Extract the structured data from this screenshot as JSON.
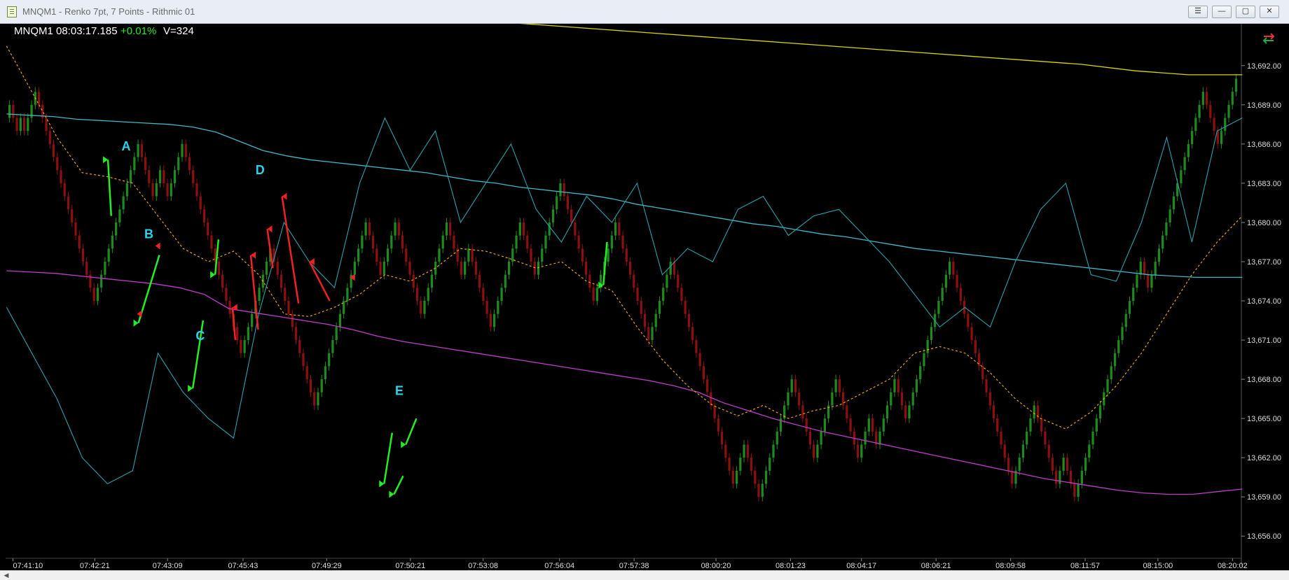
{
  "window": {
    "title": "MNQM1 - Renko 7pt, 7 Points - Rithmic 01",
    "buttons": [
      "☰",
      "—",
      "▢",
      "✕"
    ]
  },
  "header": {
    "instrument": "MNQM1",
    "time": "08:03:17.185",
    "change": "+0.01%",
    "volume": "V=324"
  },
  "colors": {
    "background": "#000000",
    "up_brick": "#1f8a1f",
    "down_brick": "#8b1010",
    "upper_band": "#3fb8c8",
    "lower_band": "#c03ccc",
    "long_ma": "#d6d600",
    "fast_ma": "#ffb000",
    "oscillator": "#2aa0ad",
    "long_signal": "#22ee22",
    "short_signal": "#ee2222",
    "annotation": "#29d3ec"
  },
  "chart_data": {
    "type": "renko",
    "brick_size_points": 7,
    "ylim": [
      13654.3,
      13695.2
    ],
    "y_ticks": [
      "13,692.00",
      "13,689.00",
      "13,686.00",
      "13,683.00",
      "13,680.00",
      "13,677.00",
      "13,674.00",
      "13,671.00",
      "13,668.00",
      "13,665.00",
      "13,662.00",
      "13,659.00",
      "13,656.00"
    ],
    "y_tick_values": [
      13692,
      13689,
      13686,
      13683,
      13680,
      13677,
      13674,
      13671,
      13668,
      13665,
      13662,
      13659,
      13656
    ],
    "x_ticks": [
      "07:41:10",
      "07:42:21",
      "07:43:09",
      "07:45:43",
      "07:49:29",
      "07:50:21",
      "07:53:08",
      "07:56:04",
      "07:57:38",
      "08:00:20",
      "08:01:23",
      "08:04:17",
      "08:06:21",
      "08:09:58",
      "08:11:57",
      "08:15:00",
      "08:20:02"
    ],
    "x_tick_positions": [
      0.25,
      4.75,
      8.75,
      12.9,
      17.5,
      22.1,
      26.1,
      30.3,
      34.4,
      38.9,
      43.0,
      46.9,
      51.0,
      55.1,
      59.2,
      63.2,
      67.3
    ],
    "brick_closes": [
      13689,
      13688,
      13687,
      13688,
      13687,
      13688,
      13689,
      13690,
      13689,
      13688,
      13687,
      13686,
      13685,
      13684,
      13683,
      13682,
      13681,
      13680,
      13679,
      13678,
      13677,
      13676,
      13675,
      13674,
      13675,
      13676,
      13677,
      13678,
      13679,
      13680,
      13681,
      13682,
      13683,
      13684,
      13685,
      13686,
      13685,
      13684,
      13683,
      13682,
      13683,
      13684,
      13683,
      13682,
      13683,
      13684,
      13685,
      13686,
      13685,
      13684,
      13683,
      13682,
      13681,
      13680,
      13679,
      13678,
      13677,
      13676,
      13675,
      13674,
      13673,
      13672,
      13671,
      13670,
      13671,
      13672,
      13673,
      13674,
      13675,
      13676,
      13677,
      13678,
      13677,
      13676,
      13675,
      13674,
      13673,
      13672,
      13671,
      13670,
      13669,
      13668,
      13667,
      13666,
      13667,
      13668,
      13669,
      13670,
      13671,
      13672,
      13673,
      13674,
      13675,
      13676,
      13677,
      13678,
      13679,
      13680,
      13679,
      13678,
      13677,
      13676,
      13677,
      13678,
      13679,
      13680,
      13679,
      13678,
      13677,
      13676,
      13675,
      13674,
      13673,
      13674,
      13675,
      13676,
      13677,
      13678,
      13679,
      13680,
      13679,
      13678,
      13677,
      13676,
      13677,
      13678,
      13677,
      13676,
      13675,
      13674,
      13673,
      13672,
      13673,
      13674,
      13675,
      13676,
      13677,
      13678,
      13679,
      13680,
      13679,
      13678,
      13677,
      13676,
      13677,
      13678,
      13679,
      13680,
      13681,
      13682,
      13683,
      13682,
      13681,
      13680,
      13679,
      13678,
      13677,
      13676,
      13675,
      13674,
      13675,
      13676,
      13677,
      13678,
      13679,
      13680,
      13679,
      13678,
      13677,
      13676,
      13675,
      13674,
      13673,
      13672,
      13671,
      13672,
      13673,
      13674,
      13675,
      13676,
      13677,
      13676,
      13675,
      13674,
      13673,
      13672,
      13671,
      13670,
      13669,
      13668,
      13667,
      13666,
      13665,
      13664,
      13663,
      13662,
      13661,
      13660,
      13661,
      13662,
      13663,
      13662,
      13661,
      13660,
      13659,
      13660,
      13661,
      13662,
      13663,
      13664,
      13665,
      13666,
      13667,
      13668,
      13667,
      13666,
      13665,
      13664,
      13663,
      13662,
      13663,
      13664,
      13665,
      13666,
      13667,
      13668,
      13667,
      13666,
      13665,
      13664,
      13663,
      13662,
      13663,
      13664,
      13665,
      13664,
      13663,
      13664,
      13665,
      13666,
      13667,
      13668,
      13667,
      13666,
      13665,
      13666,
      13667,
      13668,
      13669,
      13670,
      13671,
      13672,
      13673,
      13674,
      13675,
      13676,
      13677,
      13676,
      13675,
      13674,
      13673,
      13672,
      13671,
      13670,
      13669,
      13668,
      13667,
      13666,
      13665,
      13664,
      13663,
      13662,
      13661,
      13660,
      13661,
      13662,
      13663,
      13664,
      13665,
      13666,
      13665,
      13664,
      13663,
      13662,
      13661,
      13660,
      13661,
      13662,
      13661,
      13660,
      13659,
      13660,
      13661,
      13662,
      13663,
      13664,
      13665,
      13666,
      13667,
      13668,
      13669,
      13670,
      13671,
      13672,
      13673,
      13674,
      13675,
      13676,
      13677,
      13676,
      13675,
      13676,
      13677,
      13678,
      13679,
      13680,
      13681,
      13682,
      13683,
      13684,
      13685,
      13686,
      13687,
      13688,
      13689,
      13690,
      13689,
      13688,
      13687,
      13686,
      13687,
      13688,
      13689,
      13690,
      13691
    ],
    "series": [
      {
        "type": "line",
        "values": [
          13688.3,
          13688.2,
          13688.1,
          13687.9,
          13687.8,
          13687.7,
          13687.6,
          13687.5,
          13687.3,
          13686.9,
          13686.2,
          13685.5,
          13685.1,
          13684.8,
          13684.6,
          13684.4,
          13684.2,
          13684.0,
          13683.8,
          13683.5,
          13683.2,
          13683.0,
          13682.7,
          13682.5,
          13682.3,
          13682.1,
          13681.8,
          13681.4,
          13681.1,
          13680.8,
          13680.5,
          13680.2,
          13679.9,
          13679.7,
          13679.4,
          13679.1,
          13678.9,
          13678.6,
          13678.3,
          13678.0,
          13677.8,
          13677.6,
          13677.4,
          13677.2,
          13677.0,
          13676.8,
          13676.6,
          13676.4,
          13676.2,
          13676.0,
          13675.9,
          13675.8,
          13675.8,
          13675.8
        ]
      },
      {
        "type": "line",
        "values": [
          13676.3,
          13676.2,
          13676.1,
          13675.9,
          13675.7,
          13675.5,
          13675.3,
          13675.0,
          13674.5,
          13673.4,
          13673.1,
          13672.8,
          13672.5,
          13672.2,
          13671.8,
          13671.3,
          13670.9,
          13670.6,
          13670.3,
          13670.0,
          13669.7,
          13669.4,
          13669.1,
          13668.8,
          13668.5,
          13668.2,
          13667.9,
          13667.5,
          13667.0,
          13666.2,
          13665.6,
          13665.0,
          13664.5,
          13664.0,
          13663.6,
          13663.2,
          13662.8,
          13662.4,
          13662.0,
          13661.6,
          13661.2,
          13660.8,
          13660.4,
          13660.1,
          13659.8,
          13659.5,
          13659.3,
          13659.2,
          13659.2,
          13659.4,
          13659.6
        ]
      },
      {
        "type": "line",
        "values": [
          13697.5,
          13697.4,
          13697.3,
          13697.1,
          13696.9,
          13696.6,
          13696.3,
          13696.0,
          13695.7,
          13695.4,
          13695.1,
          13694.8,
          13694.5,
          13694.2,
          13693.9,
          13693.6,
          13693.3,
          13693.0,
          13692.7,
          13692.4,
          13692.1,
          13691.6,
          13691.3,
          13691.3
        ]
      },
      {
        "type": "line",
        "values": [
          13693.5,
          13690.0,
          13686.5,
          13683.8,
          13683.5,
          13683.0,
          13680.5,
          13678.0,
          13677.0,
          13677.8,
          13676.0,
          13673.0,
          13672.8,
          13673.5,
          13674.5,
          13676.0,
          13675.5,
          13676.5,
          13678.0,
          13677.8,
          13677.2,
          13676.5,
          13677.0,
          13675.5,
          13674.8,
          13672.0,
          13669.5,
          13667.5,
          13666.0,
          13665.2,
          13666.0,
          13665.0,
          13665.6,
          13666.0,
          13667.0,
          13668.0,
          13670.0,
          13670.5,
          13670.0,
          13668.5,
          13666.5,
          13665.0,
          13664.2,
          13665.5,
          13667.5,
          13670.0,
          13673.0,
          13676.0,
          13678.5,
          13680.5
        ]
      },
      {
        "type": "line",
        "values": [
          13673.5,
          13670.0,
          13666.5,
          13662.0,
          13660.0,
          13661.0,
          13670.0,
          13667.0,
          13665.0,
          13663.5,
          13673.0,
          13680.0,
          13677.0,
          13675.0,
          13683.0,
          13688.0,
          13684.0,
          13687.0,
          13680.0,
          13683.0,
          13686.0,
          13681.0,
          13678.5,
          13682.0,
          13680.0,
          13683.0,
          13676.0,
          13678.0,
          13677.0,
          13681.0,
          13682.0,
          13679.0,
          13680.5,
          13681.0,
          13679.0,
          13677.0,
          13674.5,
          13672.0,
          13673.5,
          13672.0,
          13677.0,
          13681.0,
          13683.0,
          13676.0,
          13675.5,
          13680.0,
          13686.5,
          13678.5,
          13687.0,
          13688.0
        ]
      }
    ],
    "signals": {
      "long": [
        {
          "x": 27.1,
          "y": 13684.8,
          "dir": "down",
          "x2": 28.0,
          "y2": 13680.5
        },
        {
          "x": 35.4,
          "y": 13672.3,
          "dir": "up",
          "x2": 41.1,
          "y2": 13677.5
        },
        {
          "x": 50.2,
          "y": 13667.3,
          "dir": "up",
          "x2": 53.0,
          "y2": 13672.5
        },
        {
          "x": 56.3,
          "y": 13676.0,
          "dir": "up",
          "x2": 57.2,
          "y2": 13678.7
        },
        {
          "x": 102.3,
          "y": 13660.0,
          "dir": "up",
          "x2": 104.5,
          "y2": 13663.9
        },
        {
          "x": 105.0,
          "y": 13659.2,
          "dir": "up",
          "x2": 107.5,
          "y2": 13660.6
        },
        {
          "x": 108.2,
          "y": 13663.0,
          "dir": "up",
          "x2": 111.1,
          "y2": 13665.0
        },
        {
          "x": 162.0,
          "y": 13675.2,
          "dir": "up",
          "x2": 163.0,
          "y2": 13678.5
        }
      ],
      "short": [
        {
          "x": 35.0,
          "y": 13673.0,
          "dir": "down"
        },
        {
          "x": 40.0,
          "y": 13678.2,
          "dir": "down"
        },
        {
          "x": 61.0,
          "y": 13673.5,
          "dir": "down",
          "x2": 61.8,
          "y2": 13671.0
        },
        {
          "x": 66.0,
          "y": 13677.5,
          "dir": "down",
          "x2": 68.0,
          "y2": 13671.8
        },
        {
          "x": 70.5,
          "y": 13679.5,
          "dir": "down",
          "x2": 72.0,
          "y2": 13676.5
        },
        {
          "x": 74.5,
          "y": 13682.0,
          "dir": "down",
          "x2": 79.0,
          "y2": 13673.8
        },
        {
          "x": 82.0,
          "y": 13677.0,
          "dir": "down",
          "x2": 87.5,
          "y2": 13674.0
        },
        {
          "x": 93.0,
          "y": 13675.8,
          "dir": "down"
        }
      ]
    },
    "labels": [
      {
        "text": "A",
        "x": 30.8,
        "y": 13685.5
      },
      {
        "text": "B",
        "x": 37.0,
        "y": 13678.8
      },
      {
        "text": "C",
        "x": 51.0,
        "y": 13671.0
      },
      {
        "text": "D",
        "x": 67.3,
        "y": 13683.7
      },
      {
        "text": "E",
        "x": 105.3,
        "y": 13666.8
      }
    ]
  }
}
